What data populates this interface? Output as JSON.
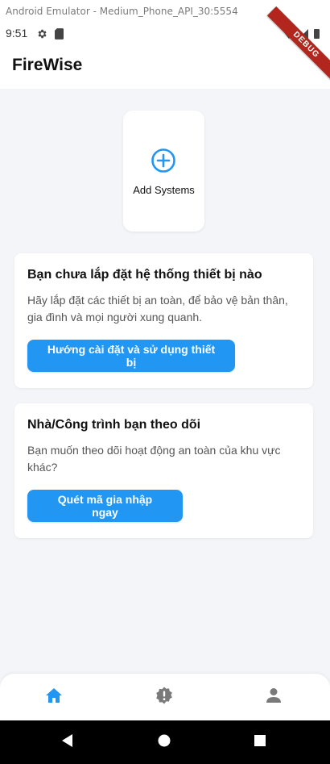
{
  "emulator": {
    "title": "Android Emulator - Medium_Phone_API_30:5554"
  },
  "status_bar": {
    "time": "9:51",
    "icons_left": [
      "gear-icon",
      "sd-card-icon"
    ],
    "icons_right": [
      "wifi-icon",
      "signal-icon",
      "battery-icon"
    ]
  },
  "debug_banner": "DEBUG",
  "app_bar": {
    "title": "FireWise"
  },
  "add_systems": {
    "label": "Add Systems",
    "icon": "add-circle-icon"
  },
  "cards": [
    {
      "title": "Bạn chưa lắp đặt hệ thống thiết bị nào",
      "description": "Hãy lắp đặt các thiết bị an toàn, để bảo vệ bản thân, gia đình và mọi người xung quanh.",
      "button_label": "Hướng cài đặt và sử dụng thiết bị"
    },
    {
      "title": "Nhà/Công trình bạn theo dõi",
      "description": "Bạn muốn theo dõi hoạt động an toàn của khu vực khác?",
      "button_label": "Quét mã gia nhập ngay"
    }
  ],
  "bottom_nav": [
    {
      "icon": "home-icon",
      "active": true
    },
    {
      "icon": "alert-badge-icon",
      "active": false
    },
    {
      "icon": "person-icon",
      "active": false
    }
  ],
  "colors": {
    "accent": "#2196f3",
    "background": "#f4f5f8",
    "inactive": "#7a7a7a",
    "debug": "#b3261e"
  }
}
